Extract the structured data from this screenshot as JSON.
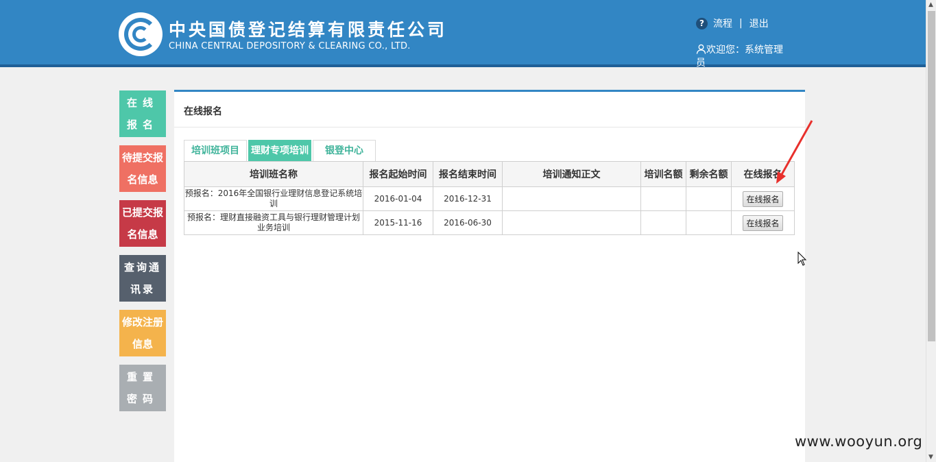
{
  "header": {
    "brand_cn": "中央国债登记结算有限责任公司",
    "brand_en": "CHINA CENTRAL DEPOSITORY & CLEARING CO., LTD.",
    "help_icon": "question-circle-icon",
    "link_flow": "流程",
    "separator": "|",
    "link_logout": "退出",
    "user_icon": "user-icon",
    "welcome": "欢迎您：系统管理员"
  },
  "sidebar": {
    "items": [
      {
        "label": "在线报名",
        "color": "#4ec7a9"
      },
      {
        "label": "待提交报名信息",
        "color": "#ef7063"
      },
      {
        "label": "已提交报名信息",
        "color": "#c63a47"
      },
      {
        "label": "查询通讯录",
        "color": "#56606d"
      },
      {
        "label": "修改注册信息",
        "color": "#f4b34c"
      },
      {
        "label": "重置密码",
        "color": "#a9aeb2"
      }
    ]
  },
  "main": {
    "title": "在线报名",
    "tabs": [
      {
        "label": "培训班项目"
      },
      {
        "label": "理财专项培训"
      },
      {
        "label": "银登中心"
      }
    ],
    "table": {
      "headers": [
        "培训班名称",
        "报名起始时间",
        "报名结束时间",
        "培训通知正文",
        "培训名额",
        "剩余名额",
        "在线报名"
      ],
      "rows": [
        {
          "name": "预报名：2016年全国银行业理财信息登记系统培训",
          "start": "2016-01-04",
          "end": "2016-12-31",
          "notice": "",
          "quota": "",
          "remaining": "",
          "action": "在线报名"
        },
        {
          "name": "预报名：理财直接融资工具与银行理财管理计划业务培训",
          "start": "2015-11-16",
          "end": "2016-06-30",
          "notice": "",
          "quota": "",
          "remaining": "",
          "action": "在线报名"
        }
      ]
    }
  },
  "watermark": "www.wooyun.org",
  "colors": {
    "header_bg": "#3286c4",
    "accent_green": "#4ec7a9",
    "annotation_red": "#e8302c"
  }
}
